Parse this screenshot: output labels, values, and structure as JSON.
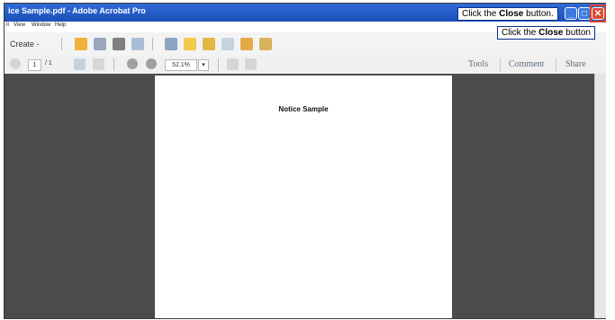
{
  "window": {
    "title": "ice Sample.pdf - Adobe Acrobat Pro"
  },
  "menu": {
    "items": [
      "it",
      "View",
      "Window",
      "Help"
    ]
  },
  "toolbar": {
    "create_label": "Create -",
    "page_current": "1",
    "page_total": "/ 1",
    "zoom_value": "52.1%"
  },
  "right_tabs": [
    "Tools",
    "Comment",
    "Share"
  ],
  "document": {
    "title": "Notice Sample"
  },
  "instructions": {
    "top_prefix": "Click the ",
    "top_bold": "Close",
    "top_suffix": " button.",
    "tooltip_prefix": "Click the ",
    "tooltip_bold": "Close",
    "tooltip_suffix": " button"
  },
  "window_buttons": {
    "minimize": "_",
    "maximize": "□",
    "close": "✕"
  },
  "colors": {
    "titlebar": "#1c4fb8",
    "close": "#dc4b32",
    "highlight": "#e0402a"
  }
}
